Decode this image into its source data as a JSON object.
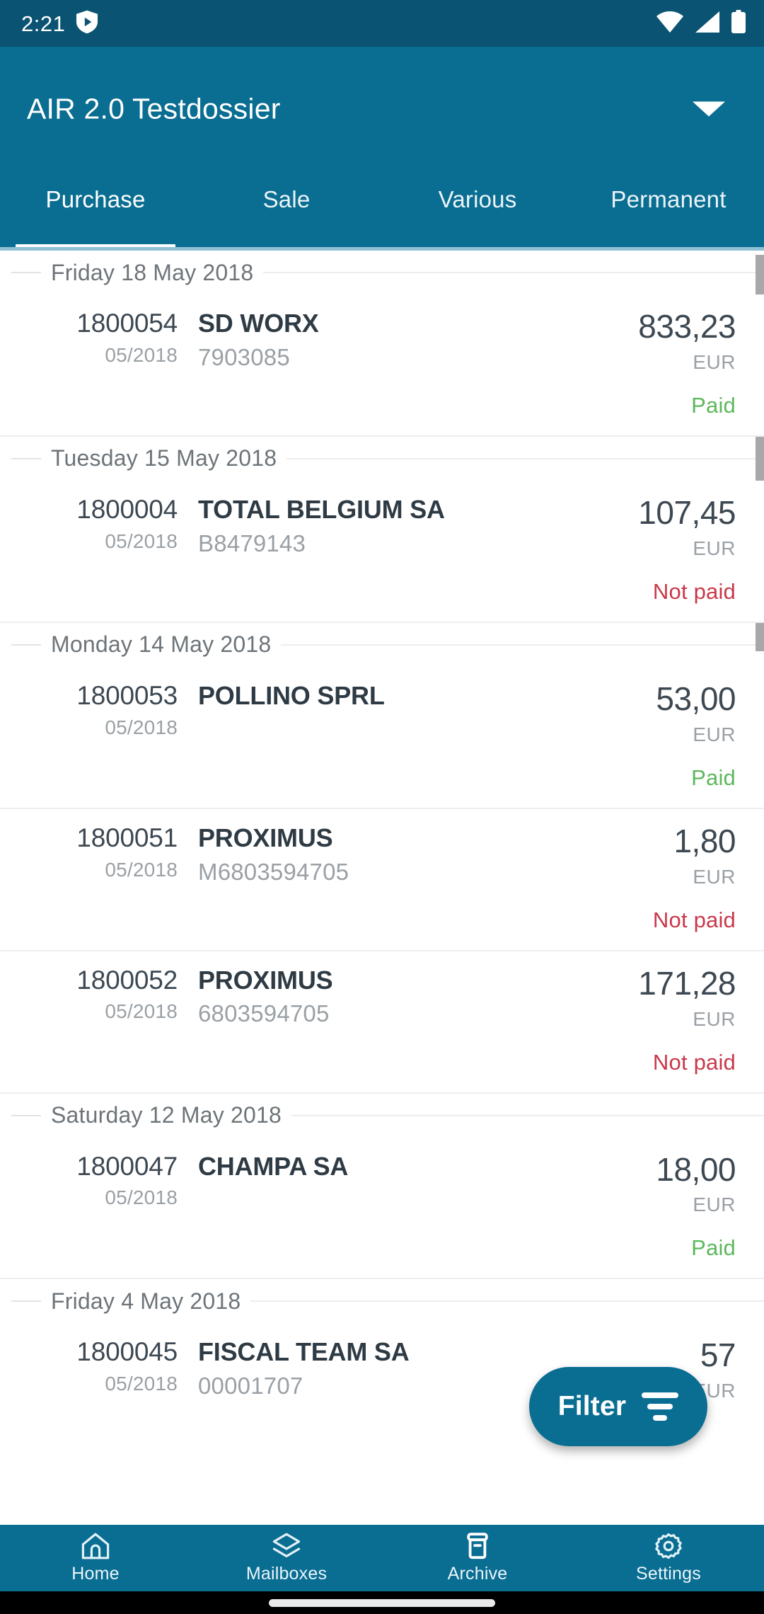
{
  "status_bar": {
    "time": "2:21",
    "left_icons": [
      "play-shield-icon"
    ],
    "right_icons": [
      "wifi-icon",
      "signal-icon",
      "battery-icon"
    ]
  },
  "header": {
    "title": "AIR 2.0 Testdossier",
    "dropdown_icon": "chevron-down-icon"
  },
  "tabs": {
    "active_index": 0,
    "items": [
      {
        "label": "Purchase"
      },
      {
        "label": "Sale"
      },
      {
        "label": "Various"
      },
      {
        "label": "Permanent"
      }
    ]
  },
  "list": {
    "groups": [
      {
        "date": "Friday 18 May 2018",
        "rows": [
          {
            "doc_no": "1800054",
            "period": "05/2018",
            "party": "SD WORX",
            "reference": "7903085",
            "amount": "833,23",
            "currency": "EUR",
            "status": "Paid",
            "status_type": "paid"
          }
        ]
      },
      {
        "date": "Tuesday 15 May 2018",
        "rows": [
          {
            "doc_no": "1800004",
            "period": "05/2018",
            "party": "TOTAL BELGIUM SA",
            "reference": "B8479143",
            "amount": "107,45",
            "currency": "EUR",
            "status": "Not paid",
            "status_type": "notpaid"
          }
        ]
      },
      {
        "date": "Monday 14 May 2018",
        "rows": [
          {
            "doc_no": "1800053",
            "period": "05/2018",
            "party": "POLLINO SPRL",
            "reference": "",
            "amount": "53,00",
            "currency": "EUR",
            "status": "Paid",
            "status_type": "paid"
          },
          {
            "doc_no": "1800051",
            "period": "05/2018",
            "party": "PROXIMUS",
            "reference": "M6803594705",
            "amount": "1,80",
            "currency": "EUR",
            "status": "Not paid",
            "status_type": "notpaid"
          },
          {
            "doc_no": "1800052",
            "period": "05/2018",
            "party": "PROXIMUS",
            "reference": "6803594705",
            "amount": "171,28",
            "currency": "EUR",
            "status": "Not paid",
            "status_type": "notpaid"
          }
        ]
      },
      {
        "date": "Saturday 12 May 2018",
        "rows": [
          {
            "doc_no": "1800047",
            "period": "05/2018",
            "party": "CHAMPA SA",
            "reference": "",
            "amount": "18,00",
            "currency": "EUR",
            "status": "Paid",
            "status_type": "paid"
          }
        ]
      },
      {
        "date": "Friday 4 May 2018",
        "rows": [
          {
            "doc_no": "1800045",
            "period": "05/2018",
            "party": "FISCAL TEAM SA",
            "reference": "00001707",
            "amount": "57",
            "currency": "EUR",
            "status": "",
            "status_type": "none"
          }
        ]
      }
    ]
  },
  "filter_button": {
    "label": "Filter",
    "icon": "filter-icon"
  },
  "bottom_nav": {
    "items": [
      {
        "label": "Home",
        "icon": "home-icon"
      },
      {
        "label": "Mailboxes",
        "icon": "layers-icon"
      },
      {
        "label": "Archive",
        "icon": "archive-box-icon"
      },
      {
        "label": "Settings",
        "icon": "gear-icon"
      }
    ]
  },
  "colors": {
    "status_bar": "#0a5372",
    "app_bar": "#0a6d92",
    "paid": "#5cb85c",
    "not_paid": "#c9384a",
    "accent": "#0a6d92"
  }
}
